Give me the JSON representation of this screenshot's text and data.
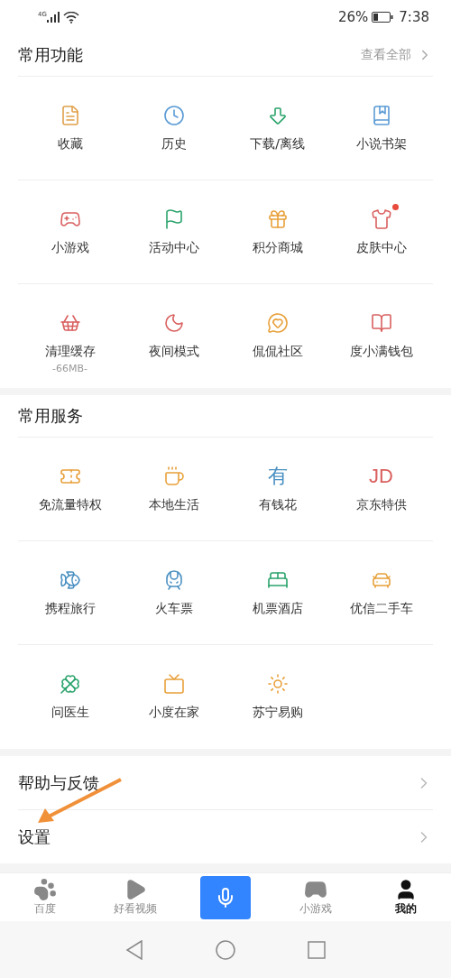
{
  "status_bar": {
    "network": "4G",
    "battery": "26%",
    "time": "7:38"
  },
  "sections": [
    {
      "title": "常用功能",
      "action": "查看全部",
      "items": [
        {
          "label": "收藏",
          "dot": false
        },
        {
          "label": "历史",
          "dot": false
        },
        {
          "label": "下载/离线",
          "dot": false
        },
        {
          "label": "小说书架",
          "dot": false
        },
        {
          "label": "小游戏",
          "dot": false
        },
        {
          "label": "活动中心",
          "dot": false
        },
        {
          "label": "积分商城",
          "dot": false
        },
        {
          "label": "皮肤中心",
          "dot": true
        },
        {
          "label": "清理缓存",
          "sub": "-66MB-",
          "dot": false
        },
        {
          "label": "夜间模式",
          "dot": false
        },
        {
          "label": "侃侃社区",
          "dot": false
        },
        {
          "label": "度小满钱包",
          "dot": false
        }
      ]
    },
    {
      "title": "常用服务",
      "items": [
        {
          "label": "免流量特权",
          "dot": false
        },
        {
          "label": "本地生活",
          "dot": false
        },
        {
          "label": "有钱花",
          "logo": "有",
          "dot": false
        },
        {
          "label": "京东特供",
          "logo": "JD",
          "dot": false
        },
        {
          "label": "携程旅行",
          "dot": false
        },
        {
          "label": "火车票",
          "dot": false
        },
        {
          "label": "机票酒店",
          "dot": false
        },
        {
          "label": "优信二手车",
          "dot": false
        },
        {
          "label": "问医生",
          "dot": false
        },
        {
          "label": "小度在家",
          "dot": false
        },
        {
          "label": "苏宁易购",
          "dot": false
        }
      ]
    }
  ],
  "links": [
    "帮助与反馈",
    "设置"
  ],
  "tab_bar": [
    {
      "kind": "tab",
      "label": "百度",
      "selected": false
    },
    {
      "kind": "tab",
      "label": "好看视频",
      "selected": false
    },
    {
      "kind": "voice"
    },
    {
      "kind": "tab",
      "label": "小游戏",
      "selected": false
    },
    {
      "kind": "tab",
      "label": "我的",
      "selected": true
    }
  ]
}
